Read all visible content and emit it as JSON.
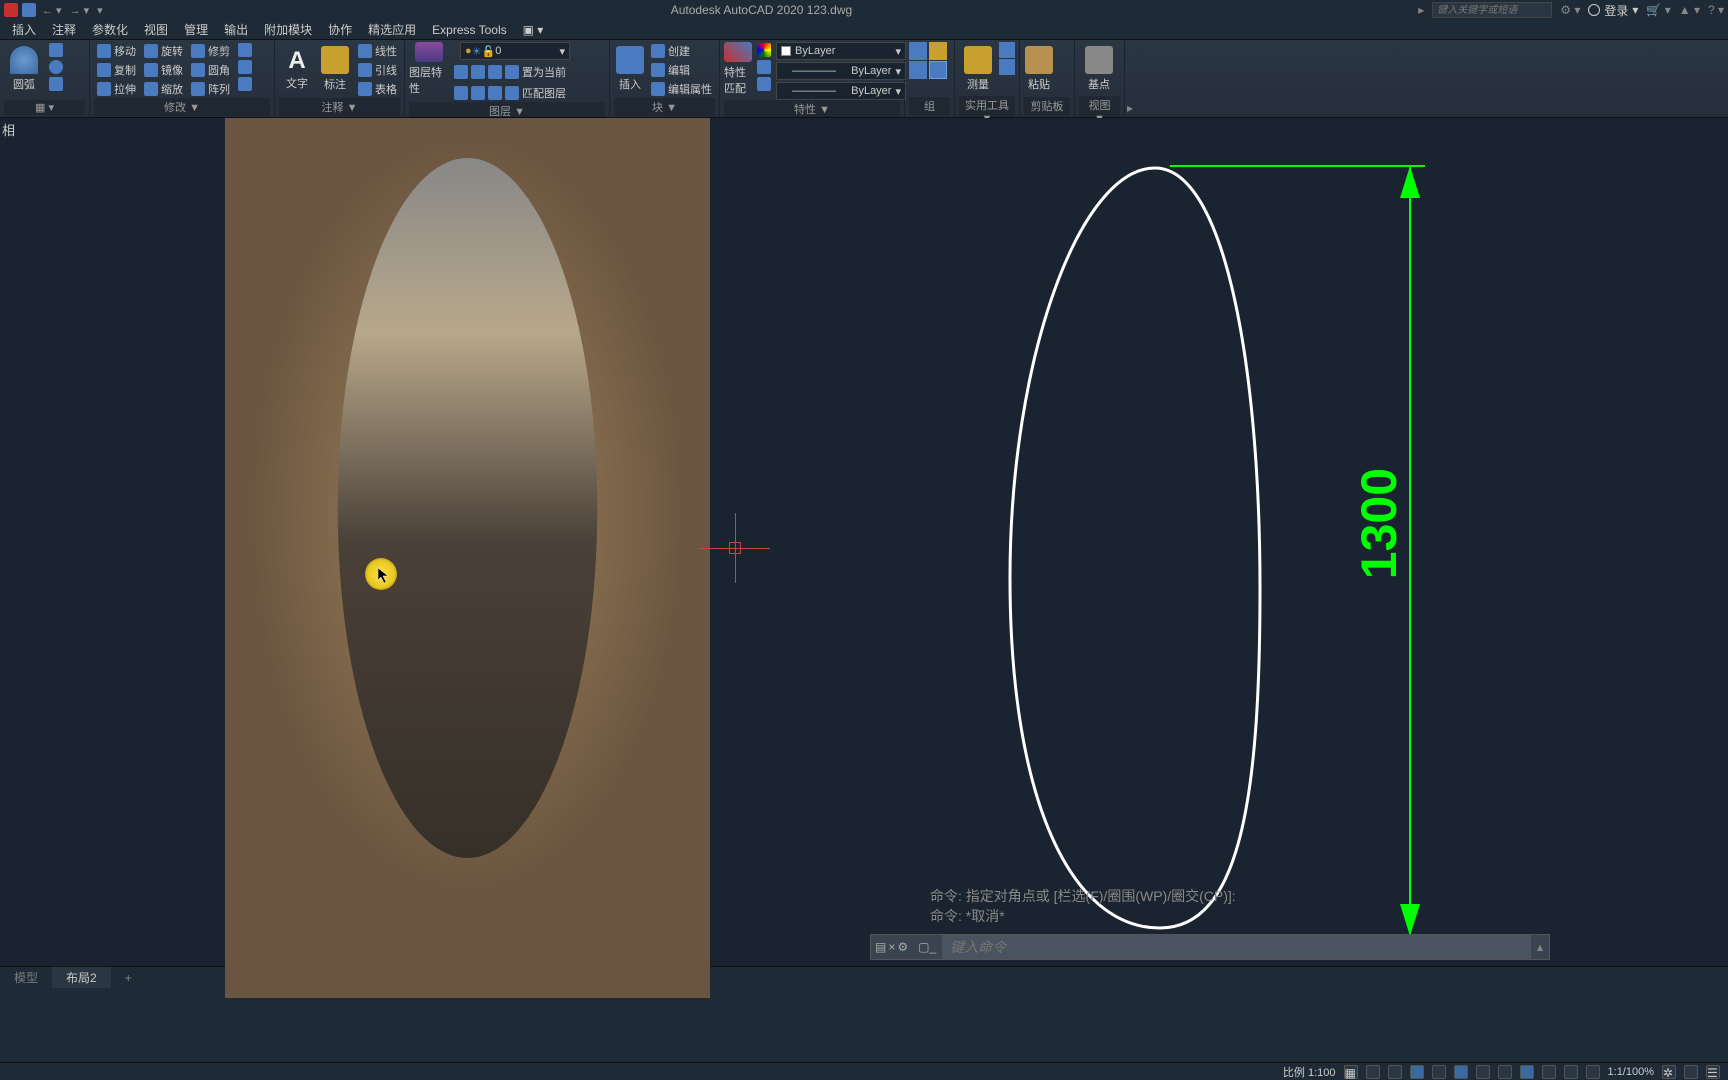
{
  "app": {
    "title": "Autodesk AutoCAD 2020   123.dwg"
  },
  "titlebar": {
    "search_placeholder": "键入关键字或短语",
    "login": "登录"
  },
  "menu": {
    "items": [
      "插入",
      "注释",
      "参数化",
      "视图",
      "管理",
      "输出",
      "附加模块",
      "协作",
      "精选应用",
      "Express Tools"
    ]
  },
  "ribbon": {
    "draw": {
      "arc": "圆弧"
    },
    "modify": {
      "title": "修改 ▼",
      "move": "移动",
      "rotate": "旋转",
      "trim": "修剪",
      "copy": "复制",
      "mirror": "镜像",
      "fillet": "圆角",
      "stretch": "拉伸",
      "scale": "缩放",
      "array": "阵列"
    },
    "annot": {
      "title": "注释 ▼",
      "text": "文字",
      "dim": "标注",
      "linear": "线性",
      "leader": "引线",
      "table": "表格"
    },
    "layer": {
      "title": "图层 ▼",
      "props": "图层特性",
      "current": "0"
    },
    "block": {
      "title": "块 ▼",
      "insert": "插入",
      "create": "创建",
      "edit": "编辑",
      "attr": "编辑属性",
      "match": "匹配图层",
      "front": "置为当前"
    },
    "props": {
      "title": "特性 ▼",
      "match": "特性匹配",
      "bylayer": "ByLayer"
    },
    "group": {
      "title": "组"
    },
    "util": {
      "title": "实用工具 ▼",
      "measure": "测量"
    },
    "clip": {
      "title": "剪贴板",
      "paste": "粘贴"
    },
    "view": {
      "title": "视图 ▼",
      "base": "基点"
    }
  },
  "drawing": {
    "dimension_value": "1300"
  },
  "cmd": {
    "line1": "命令: 指定对角点或 [栏选(F)/圈围(WP)/圈交(CP)]:",
    "line2": "命令: *取消*",
    "placeholder": "键入命令"
  },
  "tabs": {
    "model": "模型",
    "layout": "布局2",
    "add": "+"
  },
  "status": {
    "scale": "比例 1:100",
    "zoom": "1:1/100%"
  },
  "misc": {
    "frame": "相"
  }
}
